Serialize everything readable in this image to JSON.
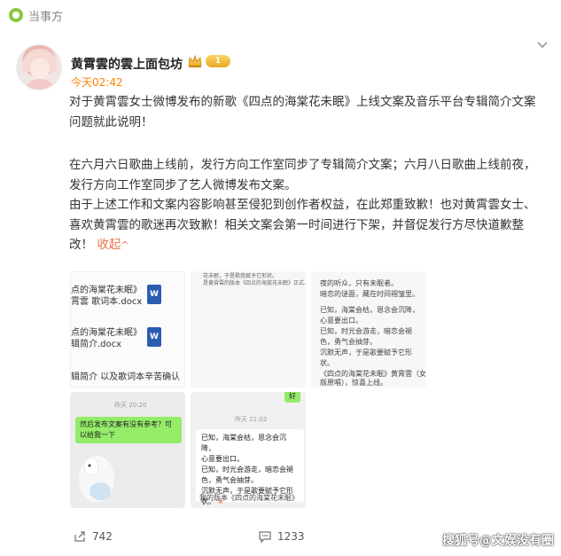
{
  "source": {
    "name": "当事方"
  },
  "post": {
    "author": "黄霄雲的雲上面包坊",
    "level_badge": "1",
    "time": "今天02:42",
    "paragraph1": "对于黄霄雲女士微博发布的新歌《四点的海棠花未眠》上线文案及音乐平台专辑简介文案问题就此说明！",
    "paragraph2": "在六月六日歌曲上线前，发行方向工作室同步了专辑简介文案；六月八日歌曲上线前夜，发行方向工作室同步了艺人微博发布文案。",
    "paragraph3_main": "由于上述工作和文案内容影响甚至侵犯到创作者权益，在此郑重致歉！也对黄霄雲女士、喜欢黄霄雲的歌迷再次致歉！相关文案会第一时间进行下架，并督促发行方尽快道歉整改！",
    "collapse_label": "收起",
    "collapse_chevron": "^"
  },
  "images": {
    "thumb1": {
      "line1": "点的海棠花未眠》",
      "line2": "霄雲 歌词本.docx",
      "line3": "点的海棠花未眠》",
      "line4": "辑简介.docx",
      "line5": "辑简介 以及歌词本辛苦确认",
      "word_icon": "W"
    },
    "thumb2": {
      "line1": "花未眠，于是歌我赋予它形状。",
      "line2": "是黄霄雲的版本《四点的海棠花未眠》正式上线。"
    },
    "thumb3": {
      "l1": "夜的听众，只有未眠者。",
      "l2": "暗恋的谜面，藏在时间褶皱里。",
      "l3": "已知，海棠会枯，恩念会沉降，",
      "l4": "心意要出口。",
      "l5": "已知，时光会游走，暗恋会褪",
      "l6": "色，勇气会抽芽。",
      "l7": "沉默无声，于是歌要赋予它形",
      "l8": "状。",
      "l9": "《四点的海棠花未眠》黄霄雲（女",
      "l10": "版原唱），惊喜上线。"
    },
    "thumb4": {
      "time": "昨天 20:20",
      "bubble": "然后发布文案有没有参考？可以给我一下"
    },
    "thumb5": {
      "top_bubble": "好",
      "time": "昨天 21:02",
      "l1": "已知，海棠会枯，恩念会沉降，",
      "l2": "心意要出口。",
      "l3": "已知，时光会游走，暗恋会褪",
      "l4": "色，勇气会抽芽。",
      "l5": "沉默无声，于是歌要赋予它形",
      "l6": "状。",
      "bottom": "我的版本《四点的海棠花未眠》"
    }
  },
  "actions": {
    "share_count": "742",
    "comment_count": "1233"
  },
  "watermark": "搜狐号@文娱没有圈",
  "colors": {
    "time_accent": "#ff8200",
    "link_accent": "#eb7350",
    "chat_green": "#95ec69"
  }
}
